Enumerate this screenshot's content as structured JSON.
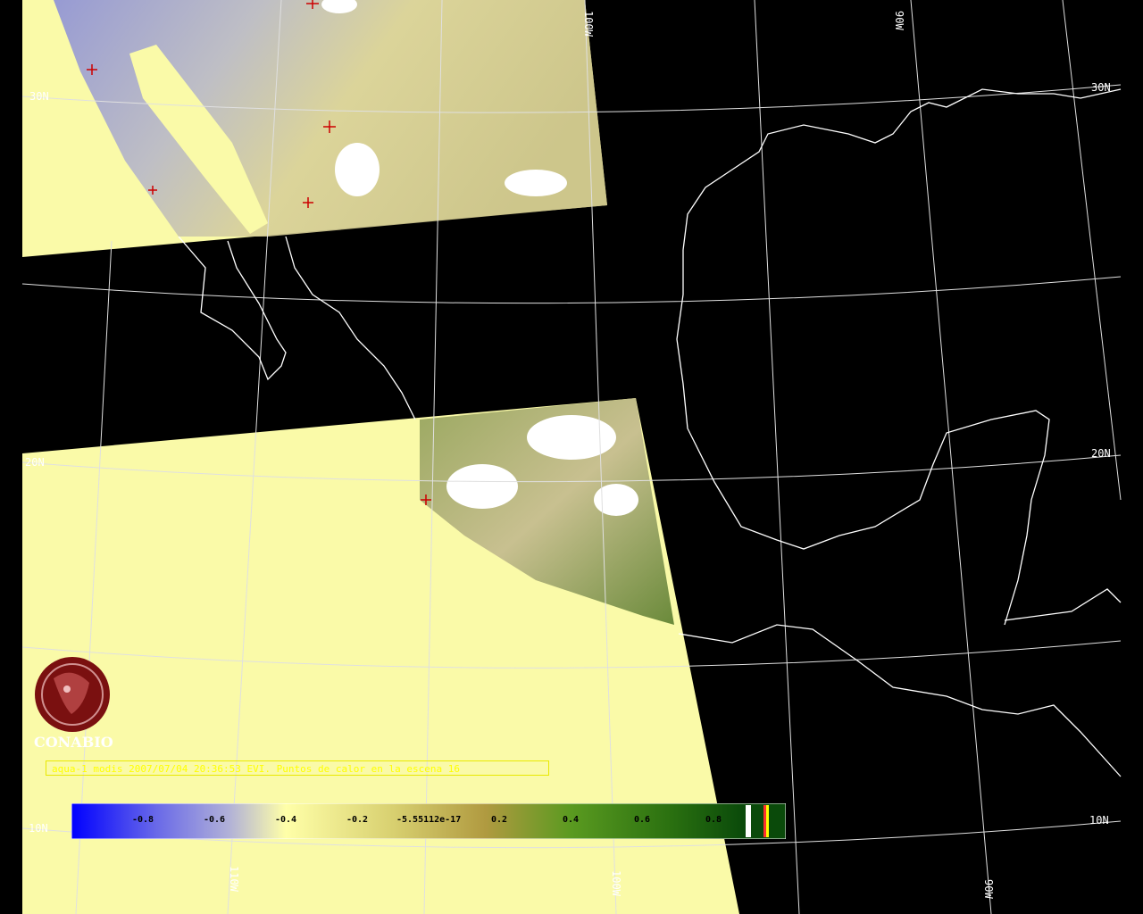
{
  "caption": "aqua-1 modis 2007/07/04 20:36:53 EVI. Puntos de calor en la escena 16",
  "logo": {
    "text": "CONABIO",
    "icon": "conabio-logo-icon"
  },
  "grid_labels": {
    "lat_30n_left": "30N",
    "lat_30n_right": "30N",
    "lat_20n_left": "20N",
    "lat_20n_right": "20N",
    "lat_10n_left": "10N",
    "lat_10n_right": "10N",
    "lon_100w_top": "100W",
    "lon_90w_top": "90W",
    "lon_110w_bottom": "110W",
    "lon_100w_bottom": "100W",
    "lon_90w_bottom": "90W"
  },
  "colorbar": {
    "ticks": [
      "-0.8",
      "-0.6",
      "-0.4",
      "-0.2",
      "-5.55112e-17",
      "0.2",
      "0.4",
      "0.6",
      "0.8"
    ],
    "colors": {
      "low": "#0000ff",
      "mid": "#ffffa8",
      "high": "#0a4a0a"
    }
  },
  "colors": {
    "background": "#000000",
    "land_fill": "#fafaa8",
    "grid": "#ffffff",
    "coast": "#ffffff",
    "hotspot": "#cc0000"
  }
}
